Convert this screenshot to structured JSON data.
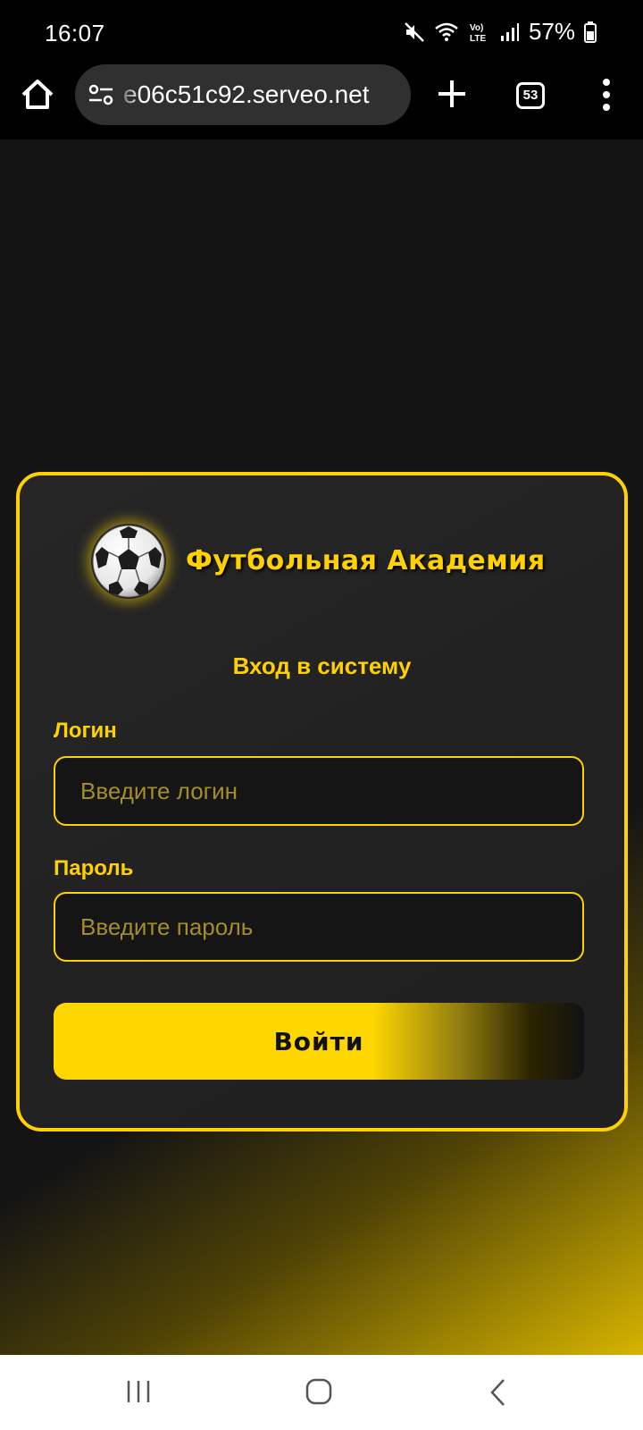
{
  "status_bar": {
    "time": "16:07",
    "battery": "57%",
    "icons": [
      "mute-icon",
      "wifi-icon",
      "volte-icon",
      "signal-icon",
      "battery-icon"
    ]
  },
  "browser": {
    "url": "e06c51c92.serveo.net",
    "tab_count": "53",
    "icons": [
      "home-icon",
      "site-settings-icon",
      "plus-icon",
      "tabs-icon",
      "more-icon"
    ]
  },
  "login_card": {
    "brand_title": "Футбольная Академия",
    "logo_icon": "soccer-ball-icon",
    "subtitle": "Вход в систему",
    "login_label": "Логин",
    "login_placeholder": "Введите логин",
    "password_label": "Пароль",
    "password_placeholder": "Введите пароль",
    "submit_label": "Войти"
  },
  "nav_bar": {
    "icons": [
      "recents-icon",
      "home-nav-icon",
      "back-icon"
    ]
  },
  "colors": {
    "accent": "#ffd100",
    "card_background": "#222222",
    "page_background": "#141414"
  }
}
